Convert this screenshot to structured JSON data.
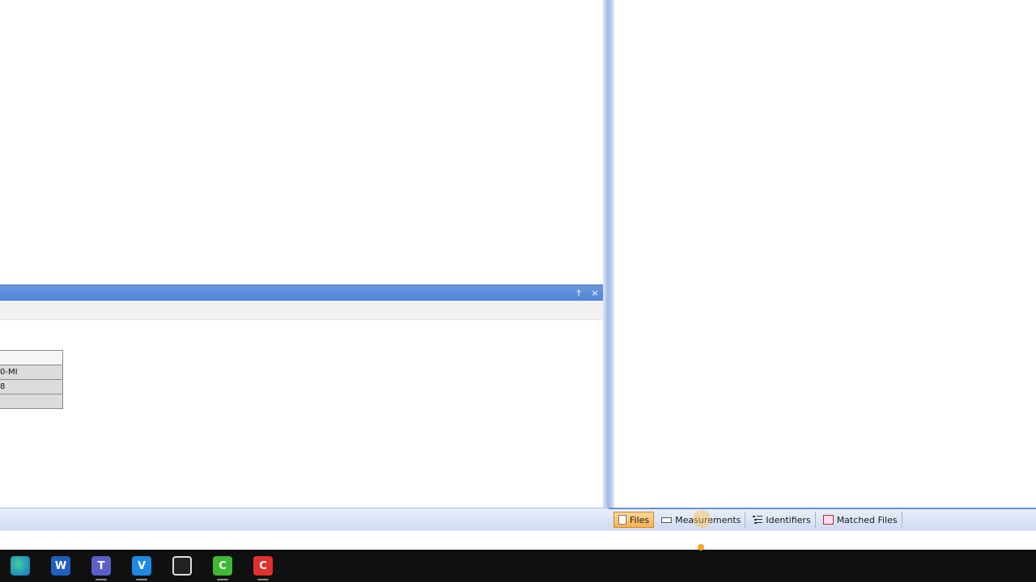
{
  "dock_panel": {
    "pin_icon": "pin-icon",
    "close_icon": "close-icon",
    "pin_glyph": "†",
    "close_glyph": "×"
  },
  "mini_table": {
    "rows": [
      "",
      "0-MI",
      "8",
      ""
    ]
  },
  "tabs": [
    {
      "label": "Files",
      "icon": "file-icon",
      "active": true
    },
    {
      "label": "Measurements",
      "icon": "measurement-icon",
      "active": false
    },
    {
      "label": "Identifiers",
      "icon": "identifiers-icon",
      "active": false
    },
    {
      "label": "Matched Files",
      "icon": "matched-files-icon",
      "active": false
    }
  ],
  "taskbar": {
    "apps": [
      {
        "name": "edge-icon",
        "glyph": ""
      },
      {
        "name": "word-icon",
        "glyph": "W"
      },
      {
        "name": "teams-icon",
        "glyph": "T"
      },
      {
        "name": "visual-studio-icon",
        "glyph": "V"
      },
      {
        "name": "obs-icon",
        "glyph": ""
      },
      {
        "name": "camtasia-icon",
        "glyph": "C"
      },
      {
        "name": "red-app-icon",
        "glyph": "C"
      }
    ]
  },
  "colors": {
    "title_bar": "#5084d8",
    "active_tab": "#f7b24e",
    "taskbar": "#101010"
  }
}
